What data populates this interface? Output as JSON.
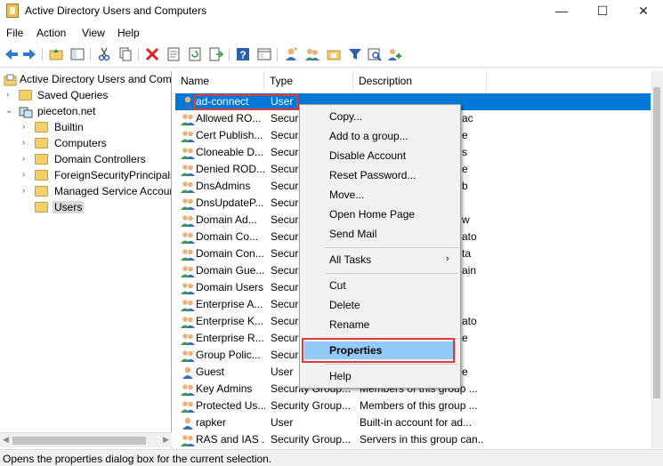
{
  "window": {
    "title": "Active Directory Users and Computers",
    "min": "—",
    "max": "☐",
    "close": "✕"
  },
  "menu": [
    "File",
    "Action",
    "View",
    "Help"
  ],
  "toolbar": [
    "back-icon",
    "forward-icon",
    "up-folder-icon",
    "show-hide-tree-icon",
    "cut-icon",
    "copy-icon",
    "delete-icon",
    "properties-icon",
    "refresh-icon",
    "export-list-icon",
    "help-icon",
    "mmc-icon",
    "new-user-icon",
    "new-group-icon",
    "new-ou-icon",
    "filter-icon",
    "find-icon",
    "add-to-group-icon"
  ],
  "tree": {
    "root": "Active Directory Users and Com",
    "items": [
      {
        "label": "Saved Queries"
      },
      {
        "label": "pieceton.net"
      },
      {
        "label": "Builtin"
      },
      {
        "label": "Computers"
      },
      {
        "label": "Domain Controllers"
      },
      {
        "label": "ForeignSecurityPrincipals"
      },
      {
        "label": "Managed Service Accour"
      },
      {
        "label": "Users"
      }
    ]
  },
  "list": {
    "headers": [
      "Name",
      "Type",
      "Description"
    ],
    "rows": [
      {
        "name": "ad-connect",
        "type": "User",
        "desc": ""
      },
      {
        "name": "Allowed RO...",
        "type": "Securi",
        "desc": ""
      },
      {
        "name": "Cert Publish...",
        "type": "Securi",
        "desc": ""
      },
      {
        "name": "Cloneable D...",
        "type": "Securi",
        "desc": ""
      },
      {
        "name": "Denied ROD...",
        "type": "Securi",
        "desc": ""
      },
      {
        "name": "DnsAdmins",
        "type": "Securi",
        "desc": ""
      },
      {
        "name": "DnsUpdateP...",
        "type": "Securi",
        "desc": ""
      },
      {
        "name": "Domain Ad...",
        "type": "Securi",
        "desc": ""
      },
      {
        "name": "Domain Co...",
        "type": "Securi",
        "desc": ""
      },
      {
        "name": "Domain Con...",
        "type": "Securi",
        "desc": ""
      },
      {
        "name": "Domain Gue...",
        "type": "Securi",
        "desc": ""
      },
      {
        "name": "Domain Users",
        "type": "Securi",
        "desc": ""
      },
      {
        "name": "Enterprise A...",
        "type": "Securi",
        "desc": ""
      },
      {
        "name": "Enterprise K...",
        "type": "Securi",
        "desc": ""
      },
      {
        "name": "Enterprise R...",
        "type": "Securi",
        "desc": ""
      },
      {
        "name": "Group Polic...",
        "type": "Securi",
        "desc": ""
      },
      {
        "name": "Guest",
        "type": "User",
        "desc": ""
      },
      {
        "name": "Key Admins",
        "type": "Security Group...",
        "desc": "Members of this group ..."
      },
      {
        "name": "Protected Us...",
        "type": "Security Group...",
        "desc": "Members of this group ..."
      },
      {
        "name": "rapker",
        "type": "User",
        "desc": "Built-in account for ad..."
      },
      {
        "name": "RAS and IAS ...",
        "type": "Security Group...",
        "desc": "Servers in this group can..."
      }
    ],
    "desc_fragments": [
      "ac",
      "e",
      "s",
      "e",
      "b",
      "",
      "w",
      "ato",
      "ta",
      "ain",
      "",
      "",
      "ato",
      "e",
      "",
      "e"
    ]
  },
  "context_menu": {
    "items": [
      "Copy...",
      "Add to a group...",
      "Disable Account",
      "Reset Password...",
      "Move...",
      "Open Home Page",
      "Send Mail",
      "All Tasks",
      "Cut",
      "Delete",
      "Rename",
      "Properties",
      "Help"
    ],
    "submenu_arrow": "›"
  },
  "status": "Opens the properties dialog box for the current selection."
}
